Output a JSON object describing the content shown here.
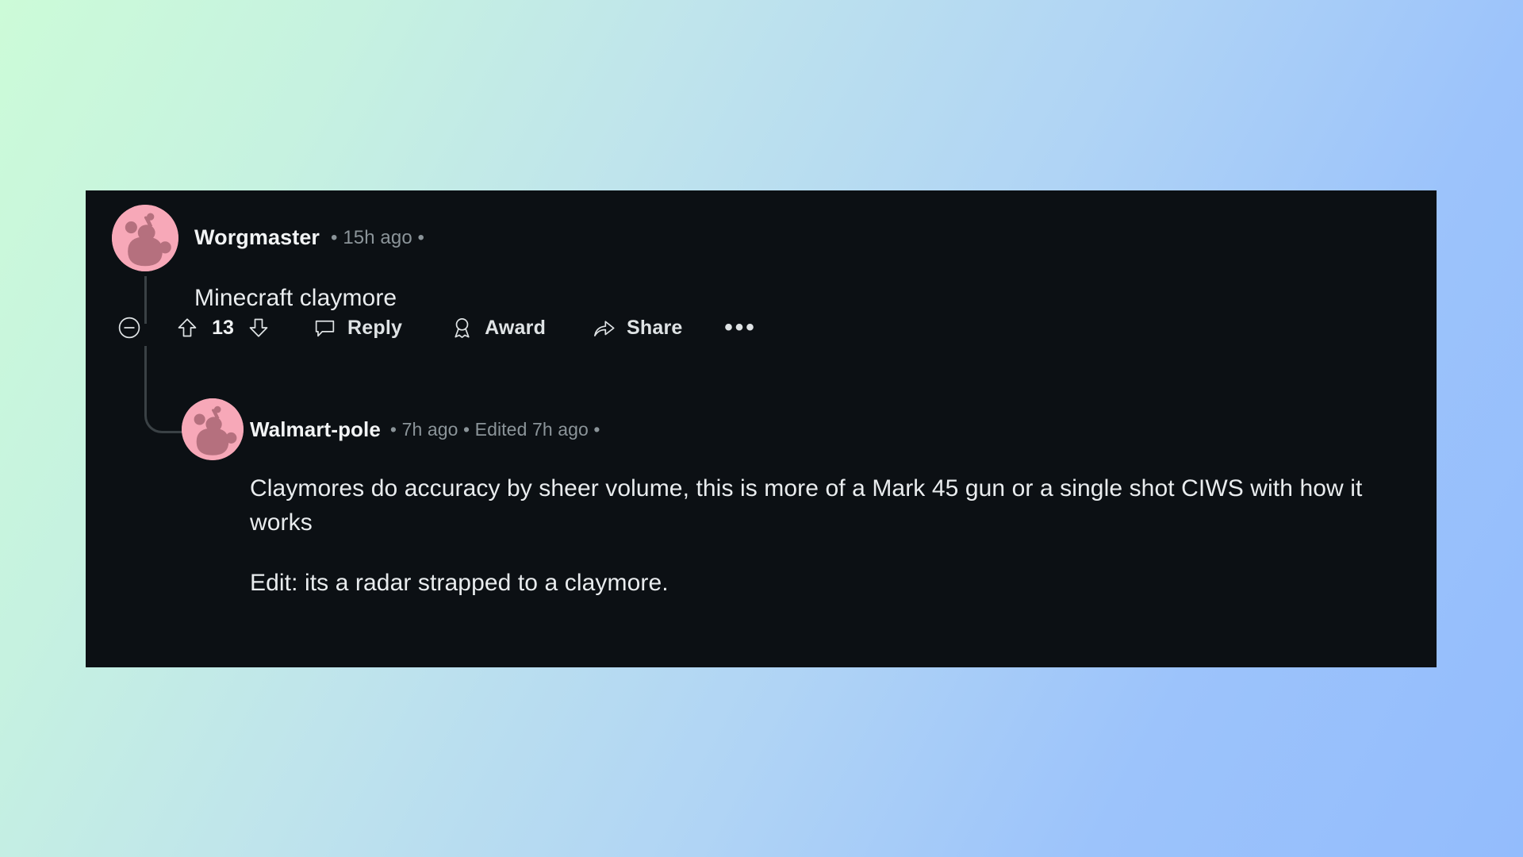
{
  "background": {
    "gradient_from": "#ccfbd8",
    "gradient_to": "#93bcfc"
  },
  "card": {
    "background": "#0c1014"
  },
  "comments": [
    {
      "id": "worgmaster",
      "author": "Worgmaster",
      "meta": "• 15h ago •",
      "avatar_icon": "reddit-snoo-avatar-icon",
      "avatar_color": "#f7a8b8",
      "body": "Minecraft claymore",
      "actions": {
        "collapse_icon": "minus-circle-icon",
        "upvote_icon": "upvote-arrow-icon",
        "vote_count": "13",
        "downvote_icon": "downvote-arrow-icon",
        "reply_icon": "comment-bubble-icon",
        "reply_label": "Reply",
        "award_icon": "award-medal-icon",
        "award_label": "Award",
        "share_icon": "share-arrow-icon",
        "share_label": "Share",
        "more_icon": "ellipsis-icon",
        "more_label": "•••"
      }
    },
    {
      "id": "walmartpole",
      "author": "Walmart-pole",
      "meta": "• 7h ago • Edited 7h ago •",
      "avatar_icon": "reddit-snoo-avatar-icon",
      "avatar_color": "#f7a8b8",
      "paragraphs": [
        "Claymores do accuracy by sheer volume, this is more of a Mark 45 gun or a single shot CIWS with how it works",
        "Edit: its a radar strapped to a claymore."
      ]
    }
  ]
}
